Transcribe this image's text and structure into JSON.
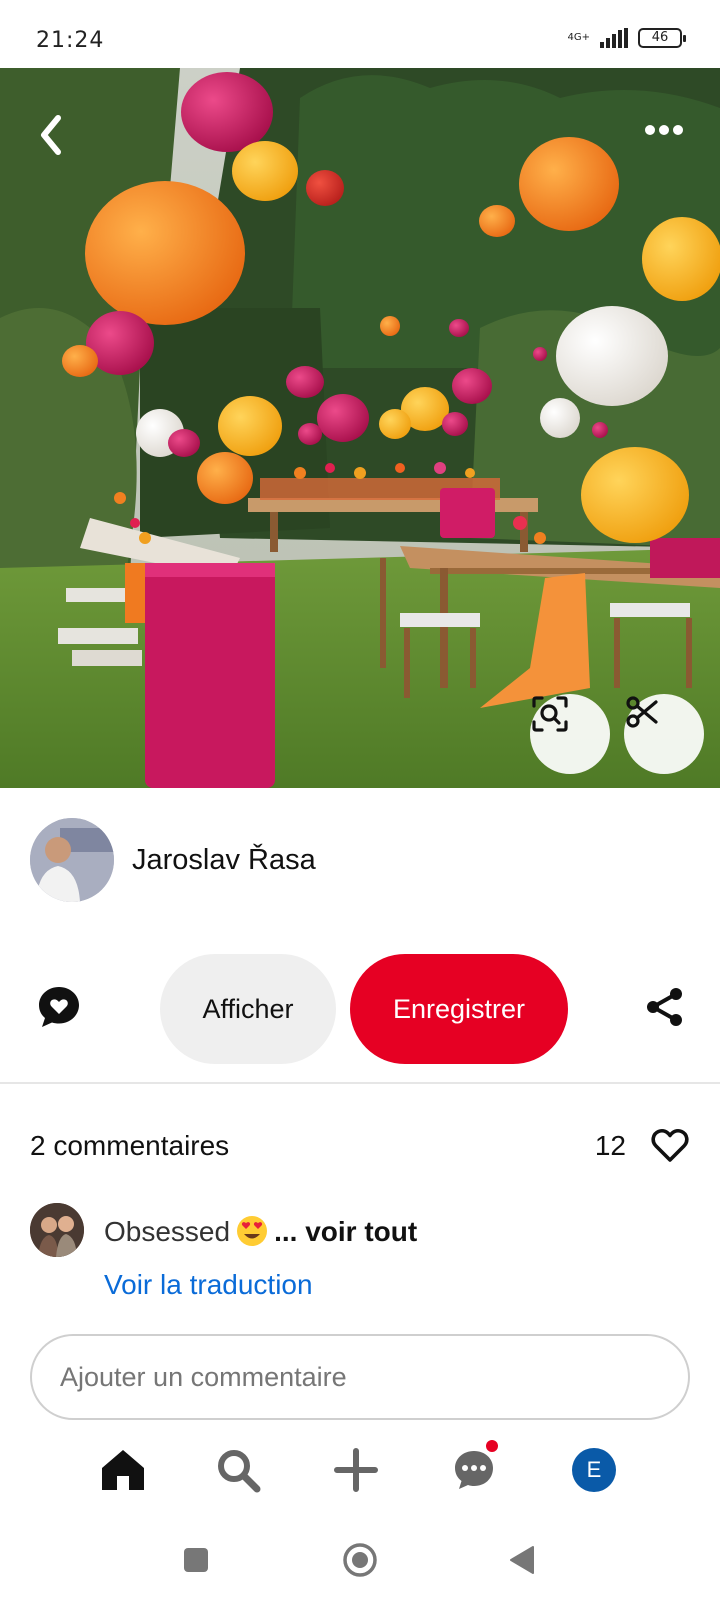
{
  "status_bar": {
    "time": "21:24",
    "network_type": "4G+",
    "battery_level": "46"
  },
  "hero": {
    "back_icon": "chevron-left-icon",
    "more_icon": "more-horizontal-icon",
    "lens_icon": "visual-search-icon",
    "scissors_icon": "scissors-icon",
    "colors": {
      "orange": "#f4811f",
      "pink": "#c8185e",
      "yellow": "#f6b820",
      "white": "#f4f1ec",
      "grass": "#5f8a2e",
      "foliage": "#2f4a24"
    }
  },
  "author": {
    "name": "Jaroslav Řasa"
  },
  "actions": {
    "comment_icon": "comment-bubble-icon",
    "view_label": "Afficher",
    "save_label": "Enregistrer",
    "share_icon": "share-icon",
    "save_color": "#e60023"
  },
  "comments": {
    "count_label": "2 commentaires",
    "likes": "12",
    "heart_icon": "heart-outline-icon",
    "items": [
      {
        "text": "Obsessed",
        "emoji": "heart-eyes-emoji",
        "see_all": "... voir tout",
        "translate": "Voir la traduction"
      }
    ],
    "input_placeholder": "Ajouter un commentaire"
  },
  "bottom_nav": {
    "items": [
      {
        "icon": "home-icon"
      },
      {
        "icon": "search-icon"
      },
      {
        "icon": "plus-icon"
      },
      {
        "icon": "messages-icon",
        "has_notification": true
      },
      {
        "icon": "profile-avatar",
        "initial": "E"
      }
    ]
  },
  "system_nav": {
    "items": [
      "recents-square-icon",
      "home-circle-icon",
      "back-triangle-icon"
    ]
  }
}
